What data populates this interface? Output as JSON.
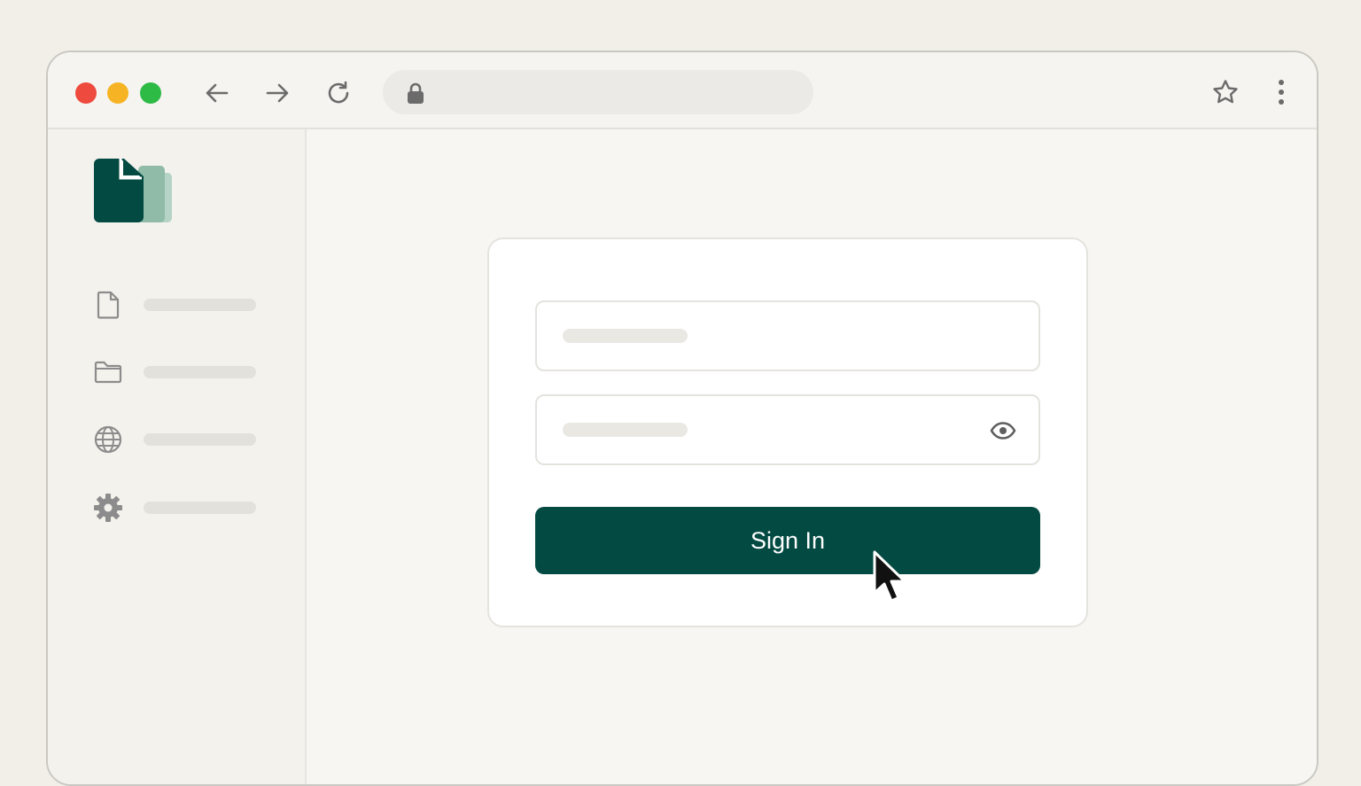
{
  "browser": {
    "controls": {
      "close": "close-window",
      "minimize": "minimize-window",
      "maximize": "maximize-window"
    },
    "nav": {
      "back_icon": "arrow-left-icon",
      "forward_icon": "arrow-right-icon",
      "reload_icon": "reload-icon"
    },
    "address_bar": {
      "icon": "lock-icon",
      "value": ""
    },
    "actions": {
      "bookmark_icon": "star-icon",
      "menu_icon": "kebab-menu-icon"
    }
  },
  "sidebar": {
    "logo_icon": "documents-logo-icon",
    "items": [
      {
        "icon": "document-icon",
        "label": ""
      },
      {
        "icon": "folder-icon",
        "label": ""
      },
      {
        "icon": "globe-icon",
        "label": ""
      },
      {
        "icon": "gear-icon",
        "label": ""
      }
    ]
  },
  "login_form": {
    "username": {
      "placeholder": "",
      "value": ""
    },
    "password": {
      "placeholder": "",
      "value": "",
      "toggle_icon": "eye-icon"
    },
    "submit_label": "Sign In"
  },
  "colors": {
    "accent": "#034a42",
    "background": "#f1efe8",
    "card": "#ffffff"
  }
}
